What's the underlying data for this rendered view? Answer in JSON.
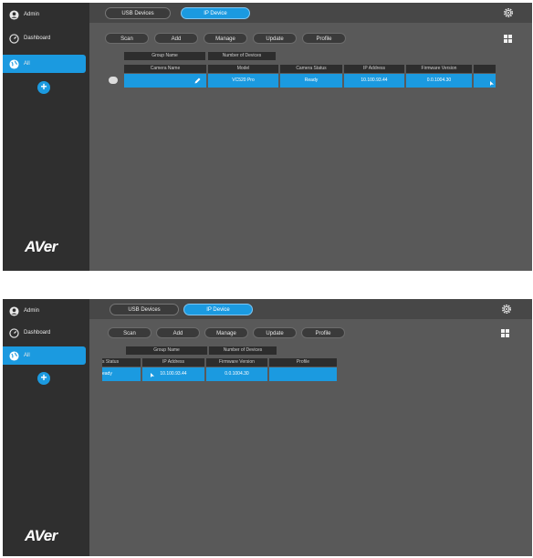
{
  "sidebar": {
    "admin_label": "Admin",
    "dashboard_label": "Dashboard",
    "group_label": "All",
    "add_symbol": "+",
    "logo_text": "AVer"
  },
  "tabs": {
    "usb": "USB Devices",
    "ip": "IP Device"
  },
  "toolbar": {
    "scan": "Scan",
    "add": "Add",
    "manage": "Manage",
    "update": "Update",
    "profile": "Profile"
  },
  "group_table": {
    "group_name": "Group Name",
    "number_of_devices": "Number of Devices"
  },
  "device_table": {
    "columns": {
      "camera_name": "Camera Name",
      "model": "Model",
      "camera_status": "Camera Status",
      "ip_address": "IP Address",
      "firmware_version": "Firmware Version",
      "profile": "Profile"
    },
    "row": {
      "camera_name": "",
      "model": "VC520 Pro",
      "camera_status": "Ready",
      "ip_address": "10.100.93.44",
      "firmware_version": "0.0.1004.30",
      "profile": ""
    }
  },
  "scrolled_view": {
    "status_header": "s Status",
    "status_cell": "eady"
  },
  "colors": {
    "accent": "#1b9ae0",
    "background": "#595959",
    "sidebar": "#2f2f2f"
  },
  "icons": [
    "user-icon",
    "dashboard-icon",
    "globe-icon",
    "plus-icon",
    "gear-icon",
    "grid-view-icon",
    "pencil-icon",
    "camera-icon",
    "cursor-icon"
  ]
}
